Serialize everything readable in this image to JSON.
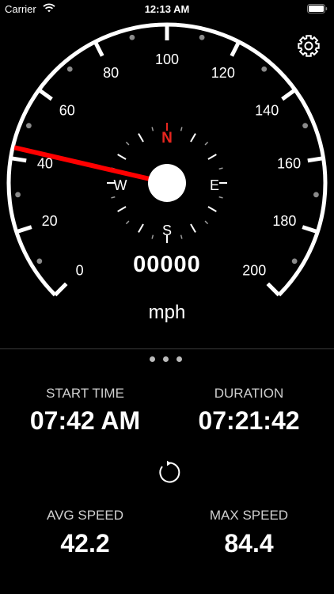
{
  "status_bar": {
    "carrier": "Carrier",
    "time": "12:13 AM"
  },
  "gauge": {
    "speed_labels": [
      "0",
      "20",
      "40",
      "60",
      "80",
      "100",
      "120",
      "140",
      "160",
      "180",
      "200"
    ],
    "needle_speed": 43,
    "needle_color": "#ff0000",
    "compass": {
      "north": "N",
      "east": "E",
      "south": "S",
      "west": "W",
      "north_color": "#e8261f"
    }
  },
  "odometer": "00000",
  "unit": "mph",
  "stats": {
    "start_time_label": "START TIME",
    "start_time_value": "07:42 AM",
    "duration_label": "DURATION",
    "duration_value": "07:21:42",
    "avg_speed_label": "AVG SPEED",
    "avg_speed_value": "42.2",
    "max_speed_label": "MAX SPEED",
    "max_speed_value": "84.4"
  },
  "icons": {
    "settings": "gear-icon",
    "reset": "reset-icon",
    "wifi": "wifi-icon",
    "battery": "battery-icon"
  }
}
